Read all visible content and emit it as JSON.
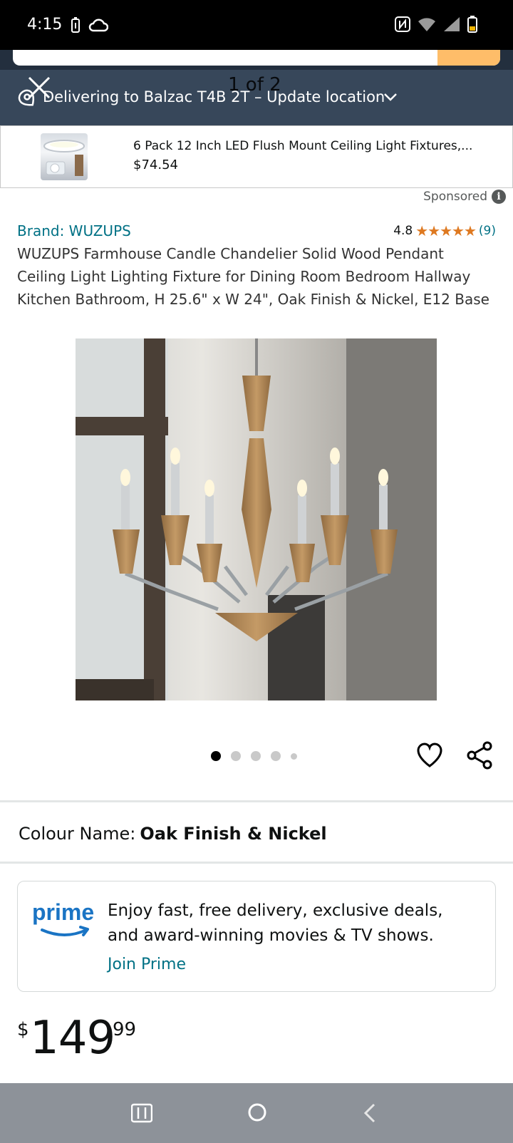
{
  "status_bar": {
    "time": "4:15",
    "left_icons": [
      "battery-saver-icon",
      "cloud-icon"
    ],
    "right_icons": [
      "nfc-icon",
      "wifi-icon",
      "signal-icon",
      "battery-icon"
    ]
  },
  "location": {
    "text": "Delivering to Balzac T4B 2T – Update location",
    "icon": "location-pin-icon"
  },
  "image_overlay": {
    "counter": "1 of 2",
    "close_icon": "close-icon"
  },
  "sponsored_ad": {
    "title": "6 Pack 12 Inch LED Flush Mount Ceiling Light Fixtures,...",
    "price": "$74.54",
    "label": "Sponsored"
  },
  "product": {
    "brand": "Brand: WUZUPS",
    "rating_value": "4.8",
    "rating_stars": 4.8,
    "review_count": "(9)",
    "title": "WUZUPS Farmhouse Candle Chandelier Solid Wood Pendant Ceiling Light Lighting Fixture for Dining Room Bedroom Hallway Kitchen Bathroom, H 25.6\" x W 24\", Oak Finish & Nickel, E12 Base"
  },
  "carousel": {
    "total_dots": 5,
    "active_index": 0
  },
  "colour": {
    "label": "Colour Name:",
    "value": "Oak Finish & Nickel"
  },
  "prime": {
    "logo_text": "prime",
    "message": "Enjoy fast, free delivery, exclusive deals, and award-winning movies & TV shows.",
    "link": "Join Prime"
  },
  "price": {
    "symbol": "$",
    "whole": "149",
    "fraction": "99"
  },
  "colors": {
    "header_dark": "#232f3e",
    "location_bar": "#37475a",
    "link": "#007185",
    "star": "#de7921",
    "prime_blue": "#1a74c4",
    "search_button": "#febd69"
  }
}
